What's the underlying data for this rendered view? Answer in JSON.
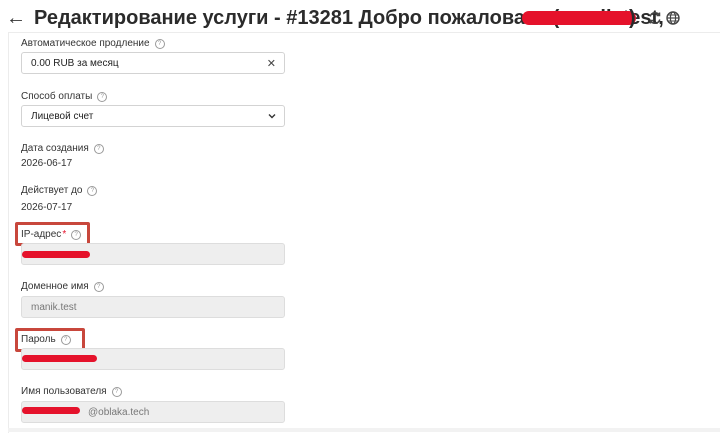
{
  "header": {
    "back_icon": "arrow-left-icon",
    "title": "Редактирование услуги - #13281 Добро пожаловать (manik.test,",
    "title_close": ")",
    "refresh_icon": "refresh-icon",
    "globe_icon": "globe-icon"
  },
  "form": {
    "auto_renew": {
      "label": "Автоматическое продление",
      "value": "0.00 RUB за месяц",
      "clear_icon": "close-icon"
    },
    "payment": {
      "label": "Способ оплаты",
      "value": "Лицевой счет",
      "icon": "chevron-down-icon"
    },
    "created": {
      "label": "Дата создания",
      "value": "2026-06-17"
    },
    "valid_until": {
      "label": "Действует до",
      "value": "2026-07-17"
    },
    "ip": {
      "label": "IP-адрес",
      "required_mark": "*",
      "value": ""
    },
    "domain": {
      "label": "Доменное имя",
      "placeholder": "manik.test"
    },
    "password": {
      "label": "Пароль",
      "value": ""
    },
    "username": {
      "label": "Имя пользователя",
      "value_suffix": "@oblaka.tech"
    },
    "help_glyph": "?"
  },
  "colors": {
    "highlight": "#c8473c",
    "redaction": "#e5122b",
    "required": "#e5122b"
  }
}
